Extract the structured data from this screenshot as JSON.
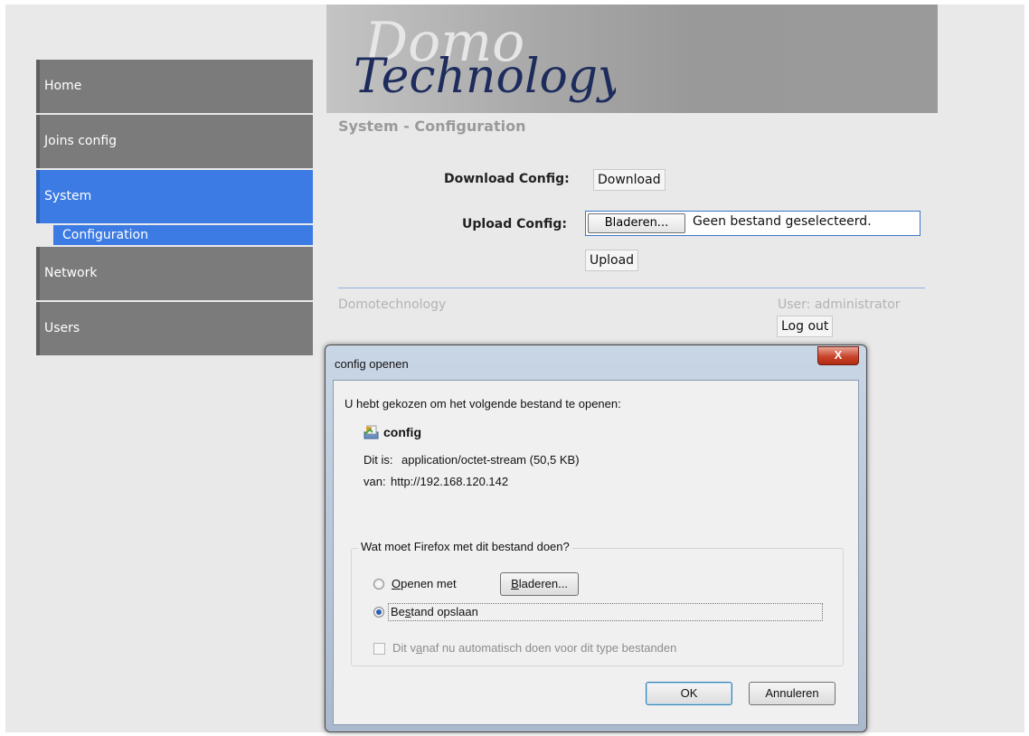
{
  "sidebar": {
    "items": [
      {
        "label": "Home"
      },
      {
        "label": "Joins config"
      },
      {
        "label": "System"
      },
      {
        "label": "Configuration"
      },
      {
        "label": "Network"
      },
      {
        "label": "Users"
      }
    ]
  },
  "header": {
    "logo_text_1": "Domo",
    "logo_text_2": "Technology"
  },
  "main": {
    "title": "System - Configuration",
    "download_label": "Download Config:",
    "download_button": "Download",
    "upload_label": "Upload Config:",
    "browse_button": "Bladeren...",
    "file_status": "Geen bestand geselecteerd.",
    "upload_button": "Upload"
  },
  "footer": {
    "company": "Domotechnology",
    "user": "User: administrator",
    "logout": "Log out"
  },
  "dialog": {
    "title": "config openen",
    "close": "X",
    "intro": "U hebt gekozen om het volgende bestand te openen:",
    "filename": "config",
    "type_label": "Dit is:",
    "type_value": "application/octet-stream (50,5 KB)",
    "from_label": "van:",
    "from_value": "http://192.168.120.142",
    "group_legend": "Wat moet Firefox met dit bestand doen?",
    "open_with_pre": "O",
    "open_with_rest": "penen met",
    "browse_pre": "B",
    "browse_rest": "laderen...",
    "save_pre": "Be",
    "save_key": "s",
    "save_rest": "tand opslaan",
    "auto_pre": "Dit v",
    "auto_key": "a",
    "auto_rest": "naf nu automatisch doen voor dit type bestanden",
    "ok": "OK",
    "cancel": "Annuleren"
  },
  "colors": {
    "nav": "#7b7b7b",
    "nav_active": "#3c7be3",
    "close_button": "#c8442b"
  }
}
